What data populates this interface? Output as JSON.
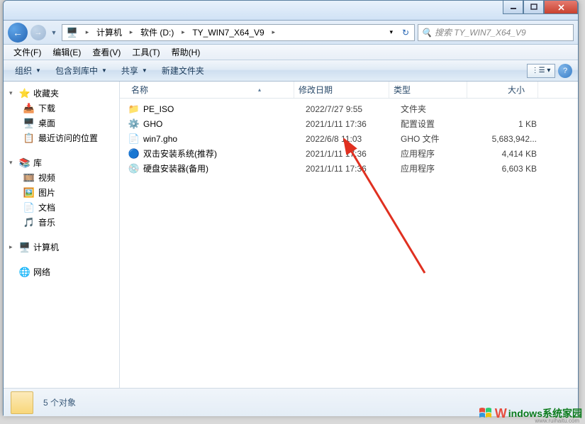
{
  "window": {
    "breadcrumb": [
      "计算机",
      "软件 (D:)",
      "TY_WIN7_X64_V9"
    ],
    "search_placeholder": "搜索 TY_WIN7_X64_V9"
  },
  "menubar": [
    "文件(F)",
    "编辑(E)",
    "查看(V)",
    "工具(T)",
    "帮助(H)"
  ],
  "toolbar": {
    "organize": "组织",
    "include": "包含到库中",
    "share": "共享",
    "newfolder": "新建文件夹"
  },
  "sidebar": {
    "favorites": {
      "label": "收藏夹",
      "items": [
        "下载",
        "桌面",
        "最近访问的位置"
      ]
    },
    "libraries": {
      "label": "库",
      "items": [
        "视频",
        "图片",
        "文档",
        "音乐"
      ]
    },
    "computer": {
      "label": "计算机"
    },
    "network": {
      "label": "网络"
    }
  },
  "columns": {
    "name": "名称",
    "date": "修改日期",
    "type": "类型",
    "size": "大小"
  },
  "files": [
    {
      "icon": "folder",
      "name": "PE_ISO",
      "date": "2022/7/27 9:55",
      "type": "文件夹",
      "size": ""
    },
    {
      "icon": "cfg",
      "name": "GHO",
      "date": "2021/1/11 17:36",
      "type": "配置设置",
      "size": "1 KB"
    },
    {
      "icon": "file",
      "name": "win7.gho",
      "date": "2022/6/8 11:03",
      "type": "GHO 文件",
      "size": "5,683,942..."
    },
    {
      "icon": "app1",
      "name": "双击安装系统(推荐)",
      "date": "2021/1/11 17:36",
      "type": "应用程序",
      "size": "4,414 KB"
    },
    {
      "icon": "app2",
      "name": "硬盘安装器(备用)",
      "date": "2021/1/11 17:36",
      "type": "应用程序",
      "size": "6,603 KB"
    }
  ],
  "statusbar": {
    "count": "5 个对象"
  },
  "watermark": {
    "text": "indows系统家园",
    "url": "www.ruihaitu.com"
  }
}
